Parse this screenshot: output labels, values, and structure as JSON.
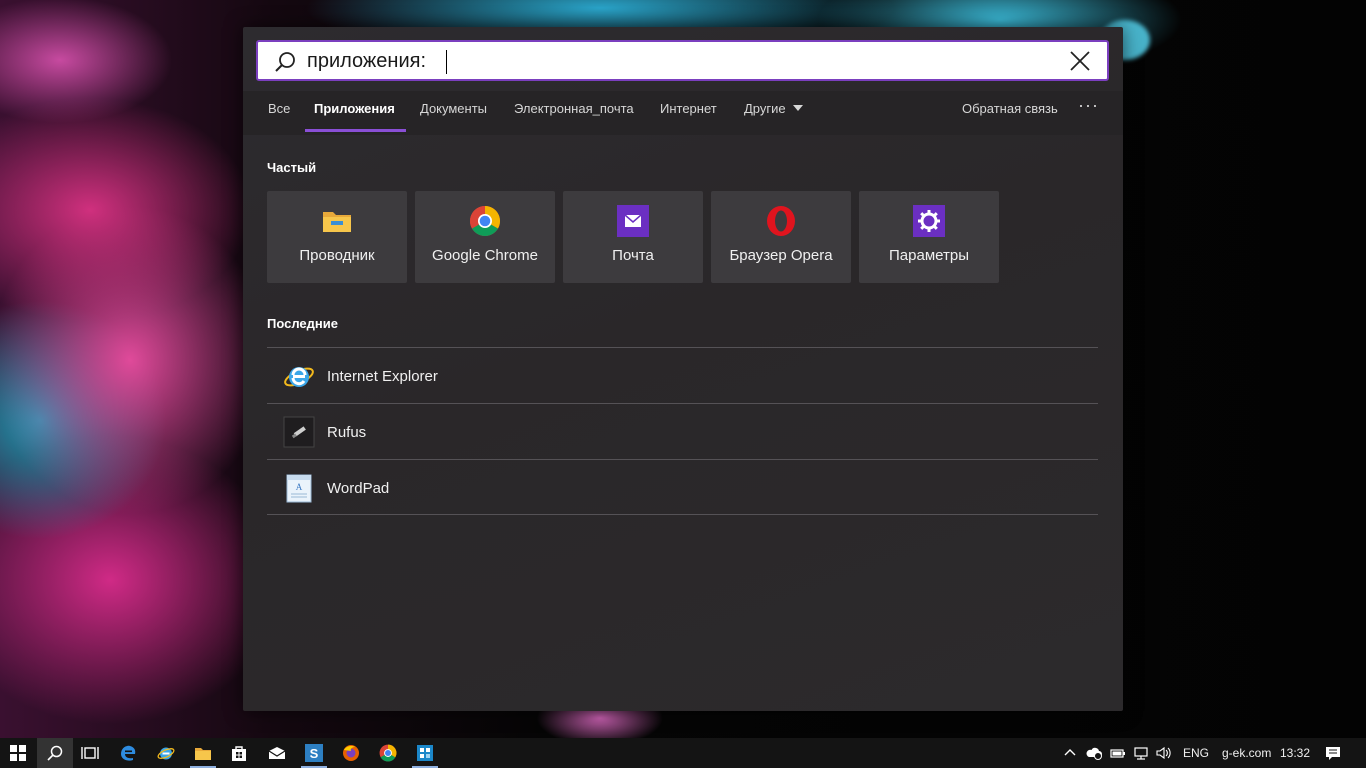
{
  "search": {
    "value": "приложения: ",
    "placeholder": ""
  },
  "tabs": {
    "all": "Все",
    "apps": "Приложения",
    "documents": "Документы",
    "email": "Электронная_почта",
    "web": "Интернет",
    "more": "Другие",
    "feedback": "Обратная связь",
    "options": "···"
  },
  "frequent": {
    "heading": "Частый",
    "items": [
      {
        "label": "Проводник",
        "icon": "folder-icon"
      },
      {
        "label": "Google Chrome",
        "icon": "chrome-icon"
      },
      {
        "label": "Почта",
        "icon": "mail-icon"
      },
      {
        "label": "Браузер Opera",
        "icon": "opera-icon"
      },
      {
        "label": "Параметры",
        "icon": "settings-gear-icon"
      }
    ]
  },
  "recent": {
    "heading": "Последние",
    "items": [
      {
        "label": "Internet Explorer",
        "icon": "internet-explorer-icon"
      },
      {
        "label": "Rufus",
        "icon": "rufus-icon"
      },
      {
        "label": "WordPad",
        "icon": "wordpad-icon"
      }
    ]
  },
  "taskbar": {
    "language": "ENG",
    "site": "g-ek.com",
    "time": "13:32"
  },
  "colors": {
    "accent": "#8a4fd6",
    "panel": "#2b292b",
    "tile": "#3d3b3e"
  }
}
